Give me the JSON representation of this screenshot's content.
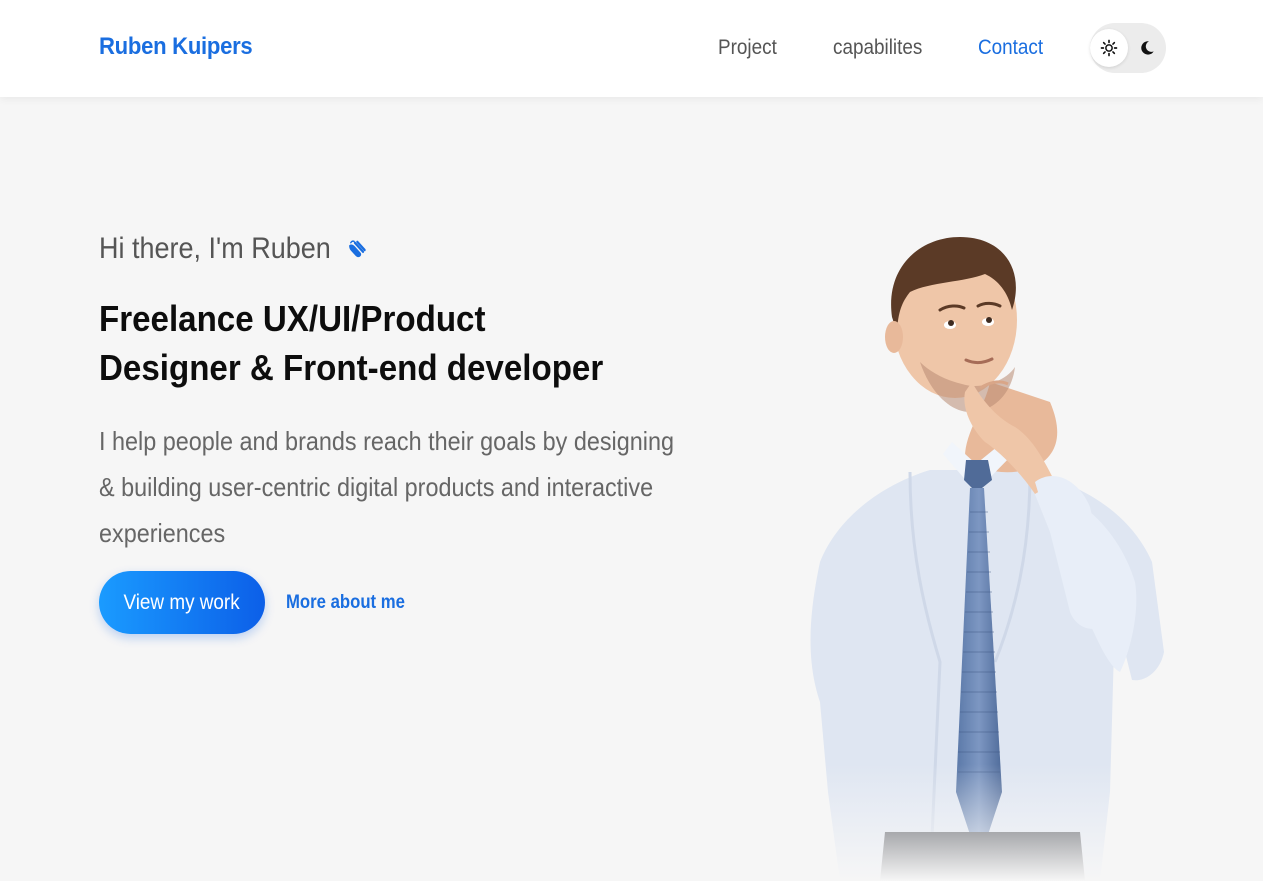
{
  "header": {
    "brand": "Ruben Kuipers",
    "nav": [
      {
        "label": "Project",
        "active": false
      },
      {
        "label": "capabilites",
        "active": false
      },
      {
        "label": "Contact",
        "active": true
      }
    ],
    "theme_toggle": {
      "selected": "light",
      "options": [
        "sun-icon",
        "moon-icon"
      ]
    }
  },
  "hero": {
    "greeting": "Hi there, I'm Ruben",
    "headline_line1": "Freelance UX/UI/Product",
    "headline_line2": "Designer & Front-end developer",
    "description": "I help people and brands reach their goals by designing & building user-centric digital products and interactive experiences",
    "primary_button": "View my work",
    "secondary_link": "More about me"
  },
  "colors": {
    "accent": "#1a6ee0",
    "background": "#f6f6f6",
    "button_gradient_start": "#1a9bff",
    "button_gradient_end": "#0c5fe8"
  }
}
